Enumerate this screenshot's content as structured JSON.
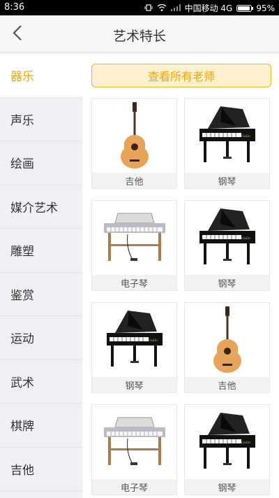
{
  "status_bar": {
    "time": "8:36",
    "carrier": "中国移动 4G",
    "battery": "95%",
    "battery_level": 0.95
  },
  "header": {
    "title": "艺术特长",
    "back_icon": "chevron-left-icon"
  },
  "sidebar": {
    "items": [
      {
        "label": "器乐",
        "active": true
      },
      {
        "label": "声乐",
        "active": false
      },
      {
        "label": "绘画",
        "active": false
      },
      {
        "label": "媒介艺术",
        "active": false
      },
      {
        "label": "雕塑",
        "active": false
      },
      {
        "label": "鉴赏",
        "active": false
      },
      {
        "label": "运动",
        "active": false
      },
      {
        "label": "武术",
        "active": false
      },
      {
        "label": "棋牌",
        "active": false
      },
      {
        "label": "吉他",
        "active": false
      }
    ]
  },
  "main": {
    "view_all_label": "查看所有老师",
    "instruments": [
      {
        "label": "吉他",
        "icon": "guitar-icon"
      },
      {
        "label": "钢琴",
        "icon": "piano-icon"
      },
      {
        "label": "电子琴",
        "icon": "keyboard-icon"
      },
      {
        "label": "钢琴",
        "icon": "piano-icon"
      },
      {
        "label": "钢琴",
        "icon": "piano-icon"
      },
      {
        "label": "吉他",
        "icon": "guitar-icon"
      },
      {
        "label": "电子琴",
        "icon": "keyboard-icon"
      },
      {
        "label": "钢琴",
        "icon": "piano-icon"
      }
    ]
  },
  "colors": {
    "accent": "#f0a500",
    "sidebar_bg": "#eef0f4"
  }
}
